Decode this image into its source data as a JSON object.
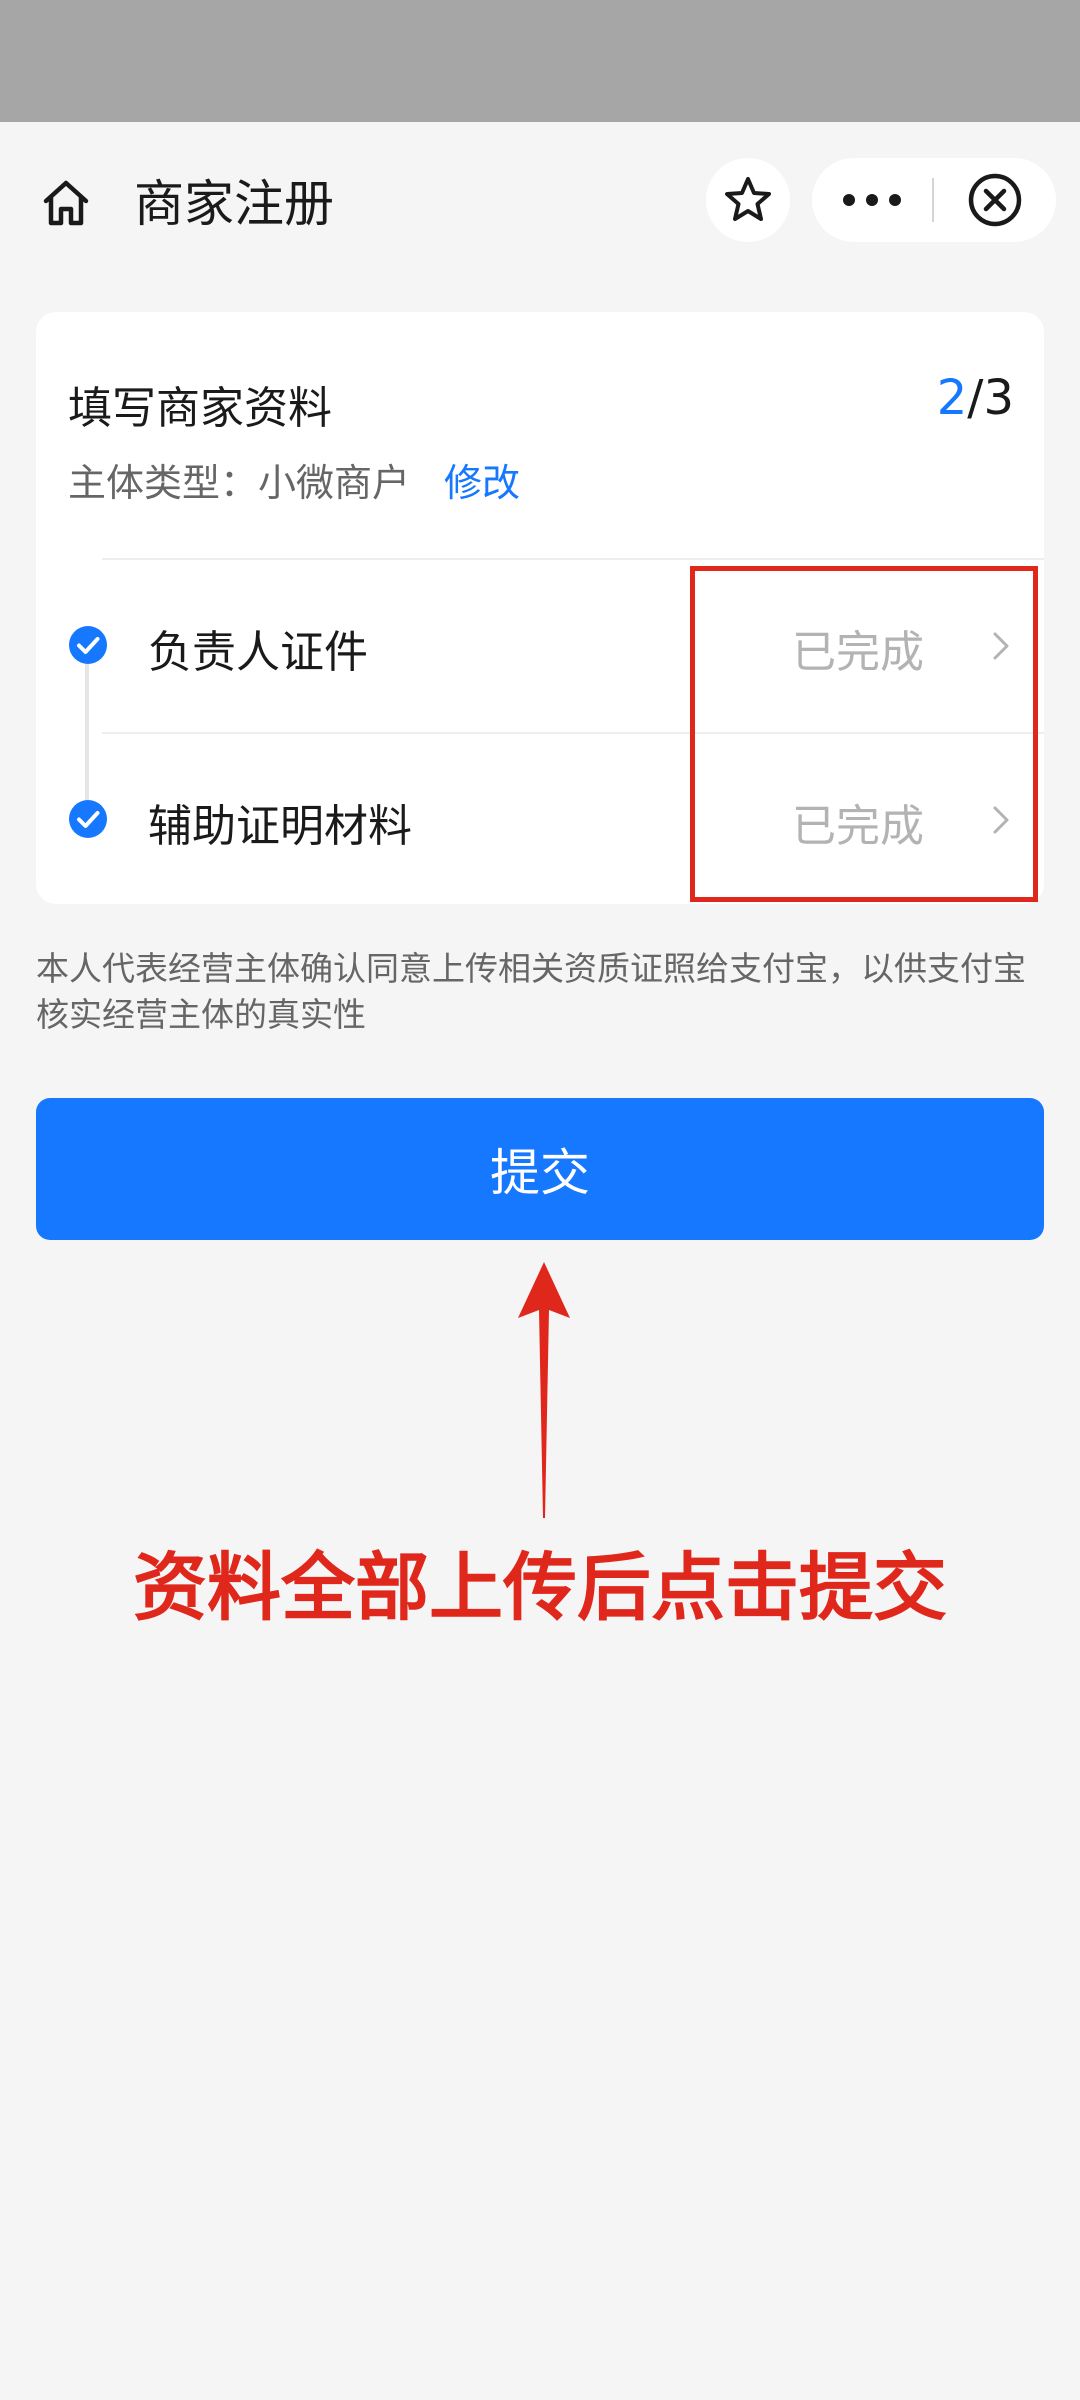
{
  "nav": {
    "title": "商家注册"
  },
  "card": {
    "title": "填写商家资料",
    "step_current": "2",
    "step_total": "/3",
    "subject_type_label": "主体类型：小微商户",
    "modify_label": "修改",
    "items": [
      {
        "label": "负责人证件",
        "status": "已完成"
      },
      {
        "label": "辅助证明材料",
        "status": "已完成"
      }
    ]
  },
  "consent_text": "本人代表经营主体确认同意上传相关资质证照给支付宝，以供支付宝核实经营主体的真实性",
  "submit_label": "提交",
  "annotation": {
    "instruction": "资料全部上传后点击提交"
  },
  "colors": {
    "accent": "#1677ff",
    "annotation_red": "#e0271b",
    "status_gray": "#b3b3b3",
    "background": "#f5f5f5"
  },
  "icons": {
    "home": "home-icon",
    "favorite": "star-icon",
    "more": "more-dots-icon",
    "close": "close-circle-icon",
    "check": "check-circle-icon",
    "chevron": "chevron-right-icon"
  }
}
